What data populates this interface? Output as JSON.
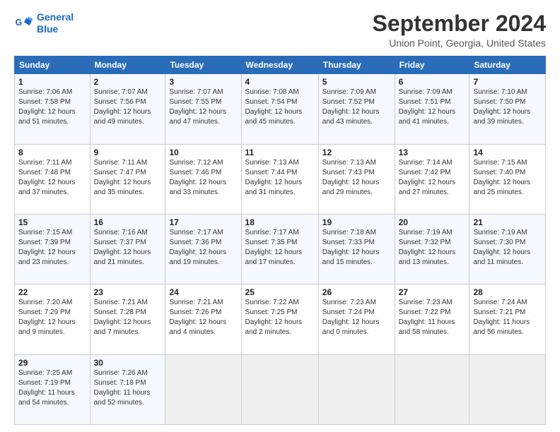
{
  "logo": {
    "line1": "General",
    "line2": "Blue"
  },
  "header": {
    "month": "September 2024",
    "location": "Union Point, Georgia, United States"
  },
  "days_of_week": [
    "Sunday",
    "Monday",
    "Tuesday",
    "Wednesday",
    "Thursday",
    "Friday",
    "Saturday"
  ],
  "weeks": [
    [
      {
        "day": "1",
        "sunrise": "7:06 AM",
        "sunset": "7:58 PM",
        "daylight": "12 hours and 51 minutes."
      },
      {
        "day": "2",
        "sunrise": "7:07 AM",
        "sunset": "7:56 PM",
        "daylight": "12 hours and 49 minutes."
      },
      {
        "day": "3",
        "sunrise": "7:07 AM",
        "sunset": "7:55 PM",
        "daylight": "12 hours and 47 minutes."
      },
      {
        "day": "4",
        "sunrise": "7:08 AM",
        "sunset": "7:54 PM",
        "daylight": "12 hours and 45 minutes."
      },
      {
        "day": "5",
        "sunrise": "7:09 AM",
        "sunset": "7:52 PM",
        "daylight": "12 hours and 43 minutes."
      },
      {
        "day": "6",
        "sunrise": "7:09 AM",
        "sunset": "7:51 PM",
        "daylight": "12 hours and 41 minutes."
      },
      {
        "day": "7",
        "sunrise": "7:10 AM",
        "sunset": "7:50 PM",
        "daylight": "12 hours and 39 minutes."
      }
    ],
    [
      {
        "day": "8",
        "sunrise": "7:11 AM",
        "sunset": "7:48 PM",
        "daylight": "12 hours and 37 minutes."
      },
      {
        "day": "9",
        "sunrise": "7:11 AM",
        "sunset": "7:47 PM",
        "daylight": "12 hours and 35 minutes."
      },
      {
        "day": "10",
        "sunrise": "7:12 AM",
        "sunset": "7:46 PM",
        "daylight": "12 hours and 33 minutes."
      },
      {
        "day": "11",
        "sunrise": "7:13 AM",
        "sunset": "7:44 PM",
        "daylight": "12 hours and 31 minutes."
      },
      {
        "day": "12",
        "sunrise": "7:13 AM",
        "sunset": "7:43 PM",
        "daylight": "12 hours and 29 minutes."
      },
      {
        "day": "13",
        "sunrise": "7:14 AM",
        "sunset": "7:42 PM",
        "daylight": "12 hours and 27 minutes."
      },
      {
        "day": "14",
        "sunrise": "7:15 AM",
        "sunset": "7:40 PM",
        "daylight": "12 hours and 25 minutes."
      }
    ],
    [
      {
        "day": "15",
        "sunrise": "7:15 AM",
        "sunset": "7:39 PM",
        "daylight": "12 hours and 23 minutes."
      },
      {
        "day": "16",
        "sunrise": "7:16 AM",
        "sunset": "7:37 PM",
        "daylight": "12 hours and 21 minutes."
      },
      {
        "day": "17",
        "sunrise": "7:17 AM",
        "sunset": "7:36 PM",
        "daylight": "12 hours and 19 minutes."
      },
      {
        "day": "18",
        "sunrise": "7:17 AM",
        "sunset": "7:35 PM",
        "daylight": "12 hours and 17 minutes."
      },
      {
        "day": "19",
        "sunrise": "7:18 AM",
        "sunset": "7:33 PM",
        "daylight": "12 hours and 15 minutes."
      },
      {
        "day": "20",
        "sunrise": "7:19 AM",
        "sunset": "7:32 PM",
        "daylight": "12 hours and 13 minutes."
      },
      {
        "day": "21",
        "sunrise": "7:19 AM",
        "sunset": "7:30 PM",
        "daylight": "12 hours and 11 minutes."
      }
    ],
    [
      {
        "day": "22",
        "sunrise": "7:20 AM",
        "sunset": "7:29 PM",
        "daylight": "12 hours and 9 minutes."
      },
      {
        "day": "23",
        "sunrise": "7:21 AM",
        "sunset": "7:28 PM",
        "daylight": "12 hours and 7 minutes."
      },
      {
        "day": "24",
        "sunrise": "7:21 AM",
        "sunset": "7:26 PM",
        "daylight": "12 hours and 4 minutes."
      },
      {
        "day": "25",
        "sunrise": "7:22 AM",
        "sunset": "7:25 PM",
        "daylight": "12 hours and 2 minutes."
      },
      {
        "day": "26",
        "sunrise": "7:23 AM",
        "sunset": "7:24 PM",
        "daylight": "12 hours and 0 minutes."
      },
      {
        "day": "27",
        "sunrise": "7:23 AM",
        "sunset": "7:22 PM",
        "daylight": "11 hours and 58 minutes."
      },
      {
        "day": "28",
        "sunrise": "7:24 AM",
        "sunset": "7:21 PM",
        "daylight": "11 hours and 56 minutes."
      }
    ],
    [
      {
        "day": "29",
        "sunrise": "7:25 AM",
        "sunset": "7:19 PM",
        "daylight": "11 hours and 54 minutes."
      },
      {
        "day": "30",
        "sunrise": "7:26 AM",
        "sunset": "7:18 PM",
        "daylight": "11 hours and 52 minutes."
      },
      null,
      null,
      null,
      null,
      null
    ]
  ]
}
